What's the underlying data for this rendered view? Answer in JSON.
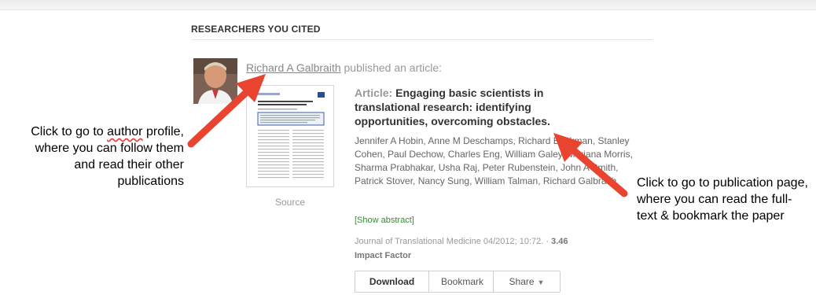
{
  "section": {
    "title": "RESEARCHERS YOU CITED"
  },
  "feed": {
    "author_name": "Richard A Galbraith",
    "action_text": " published an article:"
  },
  "article": {
    "prefix": "Article:",
    "title": "Engaging basic scientists in translational research: identifying opportunities, overcoming obstacles.",
    "authors": "Jennifer A Hobin, Anne M Deschamps, Richard Bockman, Stanley Cohen, Paul Dechow, Charles Eng, William Galey, Mariana Morris, Sharma Prabhakar, Usha Raj, Peter Rubenstein, John A Smith, Patrick Stover, Nancy Sung, William Talman, Richard Galbraith",
    "show_abstract": "[Show abstract]",
    "journal_text": "Journal of Translational Medicine 04/2012; 10:72. · ",
    "impact_value": "3.46",
    "impact_label": "Impact Factor",
    "source_label": "Source"
  },
  "actions": {
    "download": "Download",
    "bookmark": "Bookmark",
    "share": "Share"
  },
  "annotations": {
    "left": {
      "line1": "Click to go to ",
      "line1_word": "author",
      "rest": "profile, where you can follow them and read their other publications"
    },
    "right": "Click to go to publication page, where you can read the full-text & bookmark the paper",
    "arrow_color": "#e8442f"
  }
}
